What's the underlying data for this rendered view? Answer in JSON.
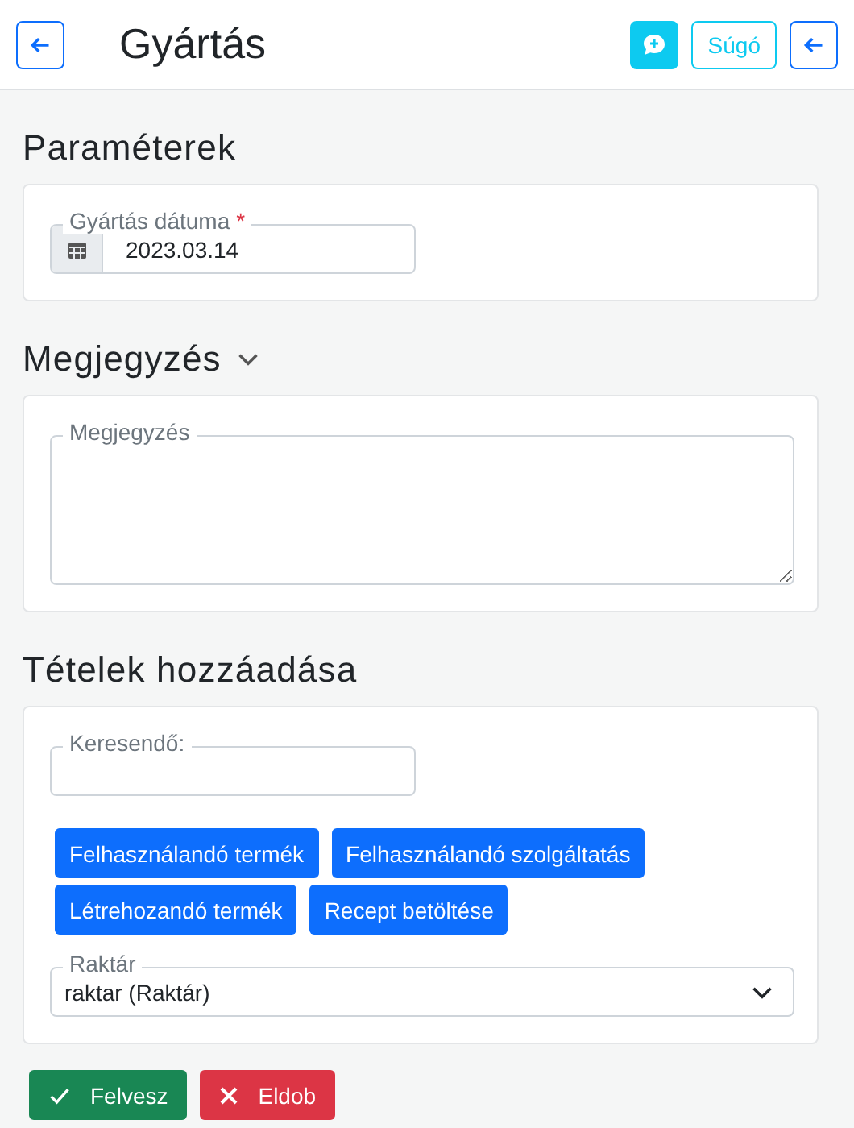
{
  "header": {
    "title": "Gyártás",
    "help_label": "Súgó"
  },
  "parameters": {
    "heading": "Paraméterek",
    "date_label": "Gyártás dátuma",
    "required_mark": "*",
    "date_value": "2023.03.14"
  },
  "note": {
    "heading": "Megjegyzés",
    "expanded": true,
    "field_label": "Megjegyzés"
  },
  "items": {
    "heading": "Tételek hozzáadása",
    "search_label": "Keresendő:",
    "buttons": [
      [
        "Felhasználandó termék",
        "Felhasználandó szolgáltatás"
      ],
      [
        "Létrehozandó termék",
        "Recept betöltése"
      ]
    ],
    "warehouse_label": "Raktár",
    "warehouse_value": "raktar (Raktár)"
  },
  "actions": [
    {
      "kind": "confirm",
      "label": "Felvesz"
    },
    {
      "kind": "discard",
      "label": "Eldob"
    }
  ]
}
